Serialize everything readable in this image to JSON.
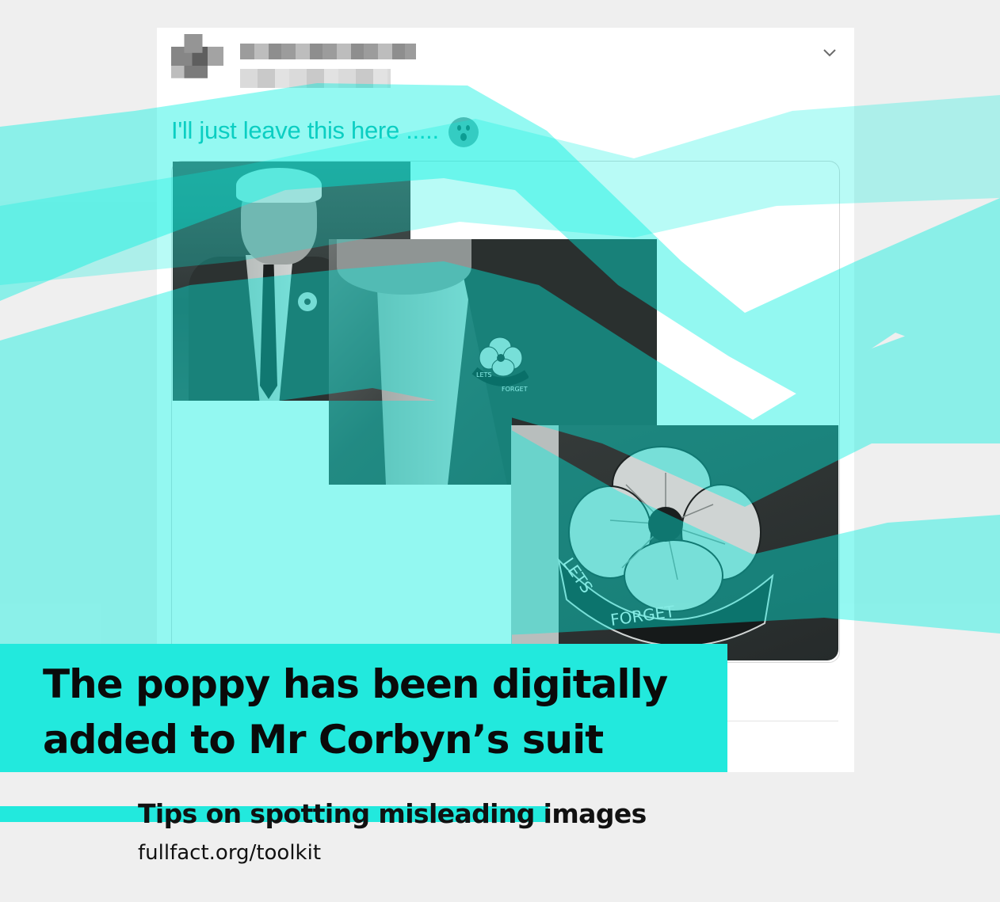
{
  "tweet": {
    "text": "I'll just leave this here .....",
    "emoji": "astonished-face",
    "menu_icon": "chevron-down"
  },
  "poppy_pin_text": {
    "small": [
      "LETS",
      "FORGET"
    ],
    "large": [
      "LETS",
      "FORGET"
    ]
  },
  "headline": {
    "line1": "The poppy has been digitally",
    "line2": "added to Mr Corbyn’s suit"
  },
  "footer": {
    "title": "Tips on spotting misleading images",
    "url": "fullfact.org/toolkit"
  },
  "colors": {
    "accent": "#22e9dd",
    "overlay": "#00f0e0",
    "background": "#efefef",
    "text": "#111111"
  }
}
